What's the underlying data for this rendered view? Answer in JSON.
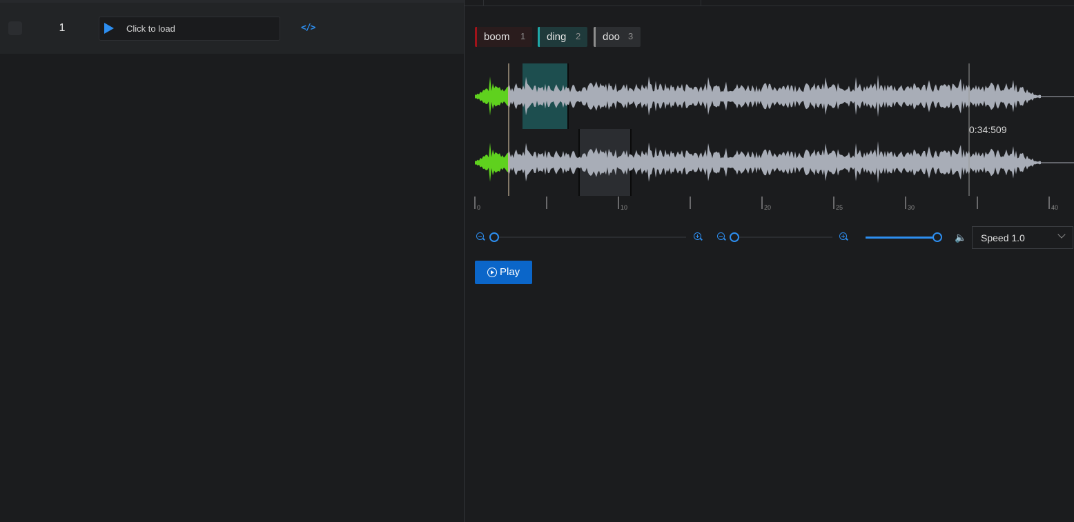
{
  "list": {
    "row_index": "1",
    "audio_label": "Click to load",
    "code_icon": "</>"
  },
  "labels": [
    {
      "name": "boom",
      "key": "1",
      "color": "#a0131a"
    },
    {
      "name": "ding",
      "key": "2",
      "color": "#1fa8a8"
    },
    {
      "name": "doo",
      "key": "3",
      "color": "#8e8e8e"
    }
  ],
  "player": {
    "time_readout": "0:34:509",
    "timeline_ticks": [
      "0",
      "10",
      "20",
      "25",
      "30",
      "40"
    ],
    "speed_label": "Speed 1.0",
    "play_label": "Play",
    "volume_level": 1.0
  },
  "colors": {
    "accent": "#2d8ef0",
    "button": "#0b66c9",
    "waveform": "#a8adb7",
    "played": "#5fd11e",
    "region_ding": "#1d4e4f",
    "region_doo": "#2b2d31"
  }
}
